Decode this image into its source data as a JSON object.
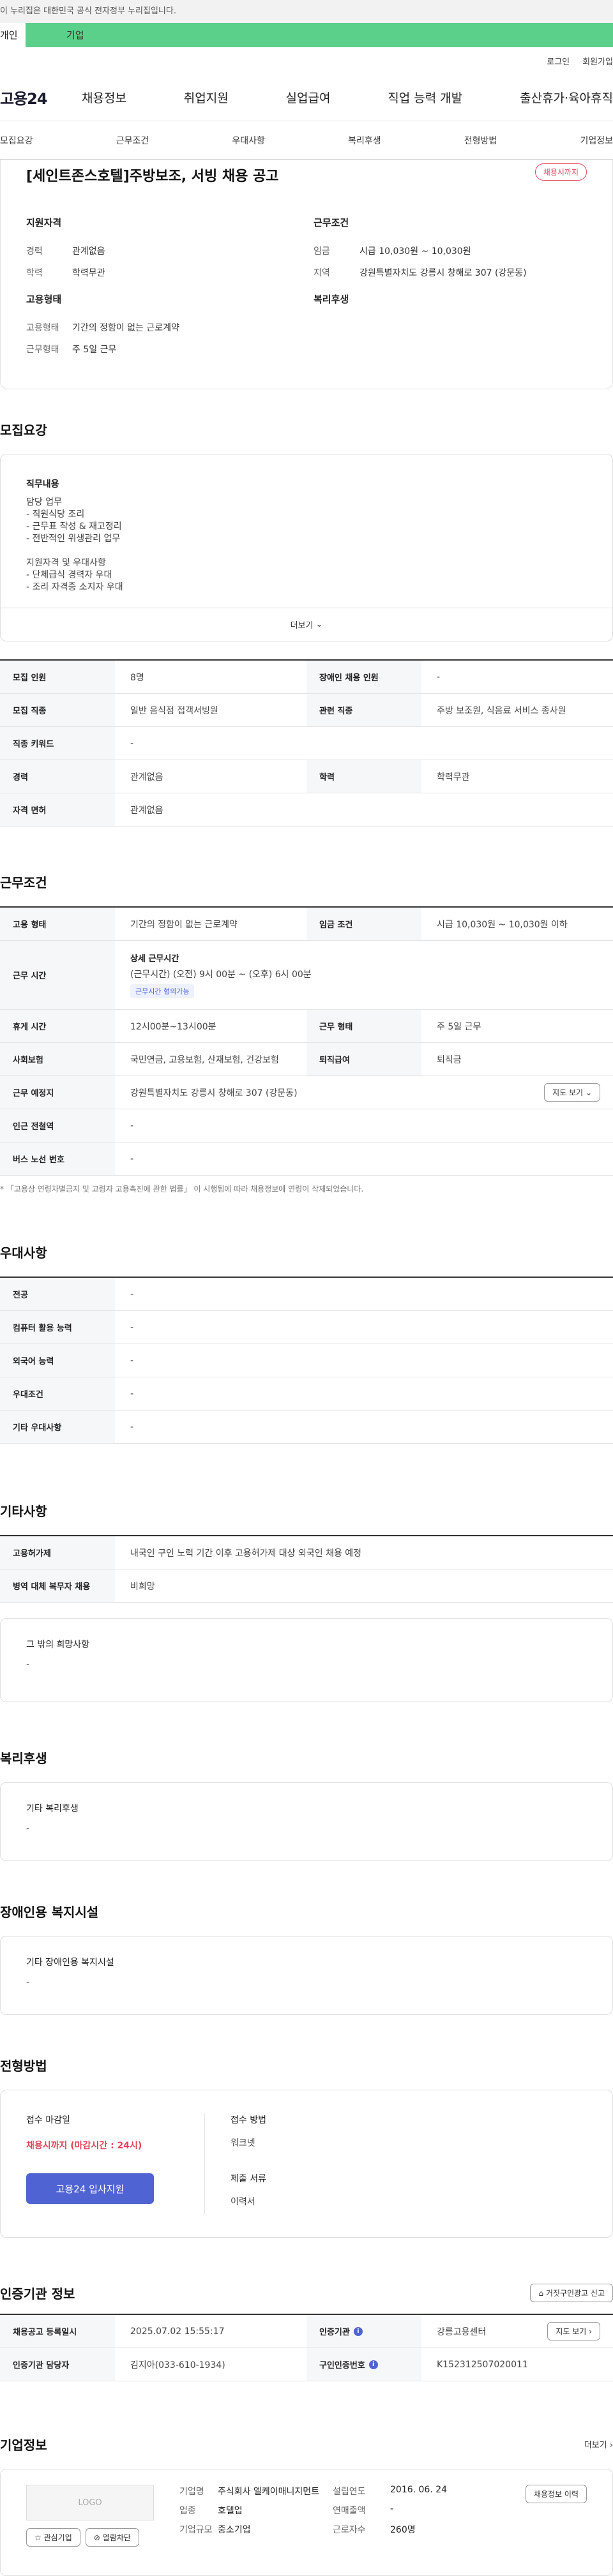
{
  "gov_banner": "이 누리집은 대한민국 공식 전자정부 누리집입니다.",
  "user_tabs": {
    "personal": "개인",
    "company": "기업"
  },
  "util": {
    "login": "로그인",
    "signup": "회원가입"
  },
  "gnb": {
    "logo": "고용24",
    "items": [
      "채용정보",
      "취업지원",
      "실업급여",
      "직업 능력 개발",
      "출산휴가·육아휴직"
    ]
  },
  "subnav": [
    "모집요강",
    "근무조건",
    "우대사항",
    "복리후생",
    "전형방법",
    "기업정보"
  ],
  "summary": {
    "title": "[세인트존스호텔]주방보조, 서빙 채용 공고",
    "status": "채용시까지",
    "qual_head": "지원자격",
    "qual": [
      {
        "k": "경력",
        "v": "관계없음"
      },
      {
        "k": "학력",
        "v": "학력무관"
      }
    ],
    "work_head": "근무조건",
    "work": [
      {
        "k": "임금",
        "v": "시급 10,030원 ~ 10,030원"
      },
      {
        "k": "지역",
        "v": "강원특별자치도 강릉시 창해로 307 (강문동)"
      }
    ],
    "emp_head": "고용형태",
    "emp": [
      {
        "k": "고용형태",
        "v": "기간의 정함이 없는 근로계약"
      },
      {
        "k": "근무형태",
        "v": "주 5일 근무"
      }
    ],
    "welfare_head": "복리후생"
  },
  "recruit": {
    "title": "모집요강",
    "duty_head": "직무내용",
    "duty_lines": [
      "담당 업무",
      "- 직원식당 조리",
      "- 근무표 작성 & 재고정리",
      "- 전반적인 위생관리 업무",
      "",
      "지원자격 및 우대사항",
      "- 단체급식 경력자 우대",
      "- 조리 자격증 소지자 우대"
    ],
    "more": "더보기",
    "rows": [
      {
        "k1": "모집 인원",
        "v1": "8명",
        "k2": "장애인 채용 인원",
        "v2": "-"
      },
      {
        "k1": "모집 직종",
        "v1": "일반 음식점 접객서빙원",
        "k2": "관련 직종",
        "v2": "주방 보조원, 식음료 서비스 종사원"
      },
      {
        "k1": "직종 키워드",
        "v1": "-"
      },
      {
        "k1": "경력",
        "v1": "관계없음",
        "k2": "학력",
        "v2": "학력무관"
      },
      {
        "k1": "자격 면허",
        "v1": "관계없음"
      }
    ]
  },
  "conditions": {
    "title": "근무조건",
    "r1": {
      "k1": "고용 형태",
      "v1": "기간의 정함이 없는 근로계약",
      "k2": "임금 조건",
      "v2": "시급 10,030원 ~ 10,030원 이하"
    },
    "r2": {
      "k": "근무 시간",
      "head": "상세 근무시간",
      "line": "(근무시간) (오전) 9시 00분 ~ (오후) 6시 00분",
      "badge": "근무시간 협의가능"
    },
    "r3": {
      "k1": "휴게 시간",
      "v1": "12시00분~13시00분",
      "k2": "근무 형태",
      "v2": "주 5일 근무"
    },
    "r4": {
      "k1": "사회보험",
      "v1": "국민연금, 고용보험, 산재보험, 건강보험",
      "k2": "퇴직급여",
      "v2": "퇴직금"
    },
    "r5": {
      "k": "근무 예정지",
      "v": "강원특별자치도 강릉시 창해로 307 (강문동)",
      "btn": "지도 보기"
    },
    "r6": {
      "k": "인근 전철역",
      "v": "-"
    },
    "r7": {
      "k": "버스 노선 번호",
      "v": "-"
    },
    "note": "* 「고용상 연령차별금지 및 고령자 고용촉진에 관한 법률」 이 시행됨에 따라 채용정보에 연령이 삭제되었습니다."
  },
  "preferred": {
    "title": "우대사항",
    "rows": [
      {
        "k": "전공",
        "v": "-"
      },
      {
        "k": "컴퓨터 활용 능력",
        "v": "-"
      },
      {
        "k": "외국어 능력",
        "v": "-"
      },
      {
        "k": "우대조건",
        "v": "-"
      },
      {
        "k": "기타 우대사항",
        "v": "-"
      }
    ]
  },
  "etc": {
    "title": "기타사항",
    "rows": [
      {
        "k": "고용허가제",
        "v": "내국인 구인 노력 기간 이후 고용허가제 대상 외국인 채용 예정"
      },
      {
        "k": "병역 대체 복무자 채용",
        "v": "비희망"
      }
    ],
    "box_head": "그 밖의 희망사항",
    "box_val": "-"
  },
  "welfare": {
    "title": "복리후생",
    "head": "기타 복리후생",
    "val": "-"
  },
  "disability": {
    "title": "장애인용 복지시설",
    "head": "기타 장애인용 복지시설",
    "val": "-"
  },
  "selection": {
    "title": "전형방법",
    "deadline_head": "접수 마감일",
    "deadline_val": "채용시까지 (마감시간 : 24시)",
    "apply_btn": "고용24 입사지원",
    "method_head": "접수 방법",
    "method_val": "워크넷",
    "docs_head": "제출 서류",
    "docs_val": "이력서"
  },
  "agency": {
    "title": "인증기관 정보",
    "report_btn": "거짓구인광고 신고",
    "r1": {
      "k1": "채용공고 등록일시",
      "v1": "2025.07.02 15:55:17",
      "k2": "인증기관",
      "v2": "강릉고용센터",
      "btn": "지도 보기"
    },
    "r2": {
      "k1": "인증기관 담당자",
      "v1": "김지아(033-610-1934)",
      "k2": "구인인증번호",
      "v2": "K152312507020011"
    }
  },
  "company": {
    "title": "기업정보",
    "more": "더보기",
    "logo": "LOGO",
    "fav_btn": "관심기업",
    "block_btn": "열람차단",
    "fields": {
      "name_k": "기업명",
      "name_v": "주식회사 엘케이매니지먼트",
      "biz_k": "업종",
      "biz_v": "호텔업",
      "size_k": "기업규모",
      "size_v": "중소기업",
      "est_k": "설립연도",
      "est_v": "2016. 06. 24",
      "sales_k": "연매출액",
      "sales_v": "-",
      "emp_k": "근로자수",
      "emp_v": "260명"
    },
    "history_btn": "채용정보 이력"
  }
}
